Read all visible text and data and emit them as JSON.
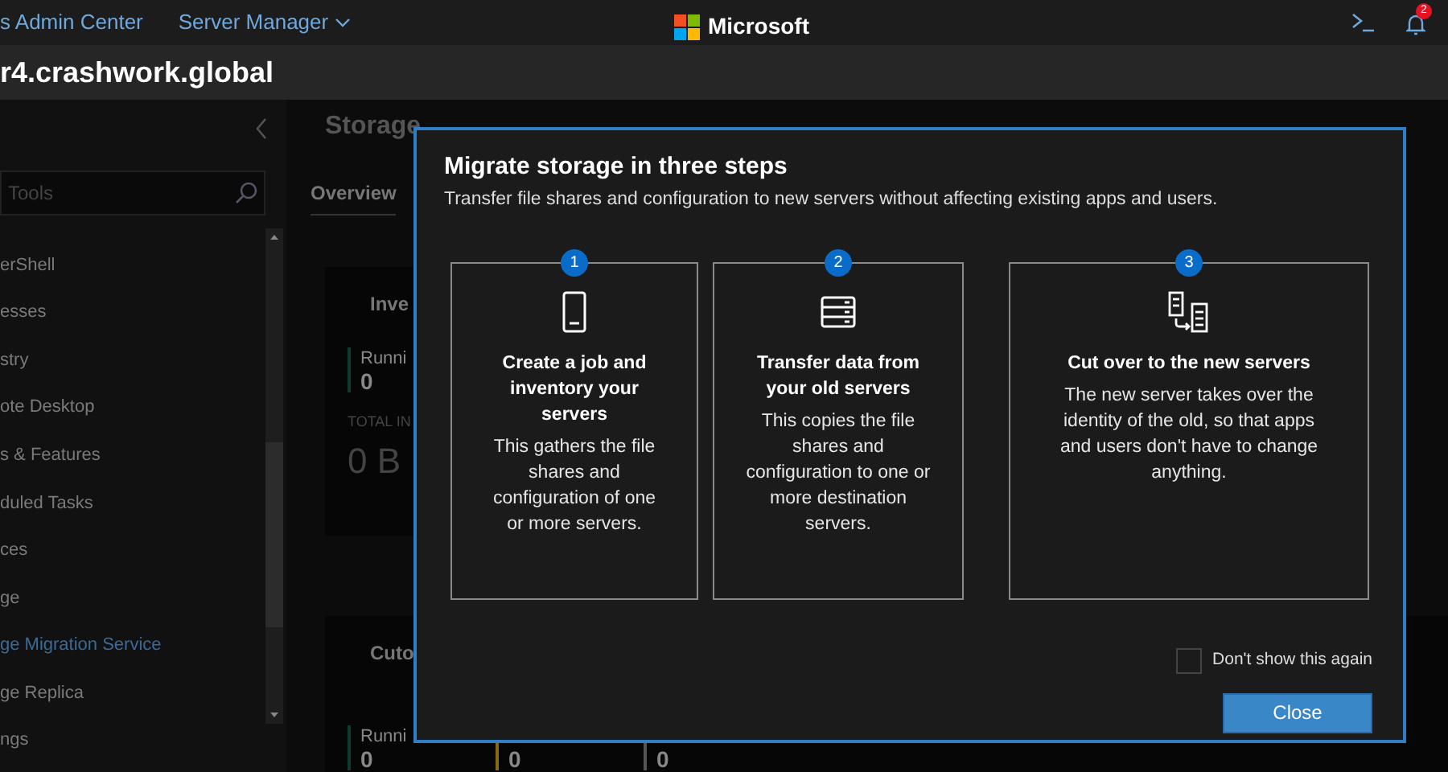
{
  "top_bar": {
    "app_title": "s Admin Center",
    "menu": "Server Manager",
    "brand": "Microsoft",
    "notification_count": "2"
  },
  "header": {
    "server_name": "r4.crashwork.global"
  },
  "sidebar": {
    "search": {
      "placeholder": "Tools"
    },
    "items": [
      {
        "label": "erShell",
        "selected": false
      },
      {
        "label": "esses",
        "selected": false
      },
      {
        "label": "stry",
        "selected": false
      },
      {
        "label": "ote Desktop",
        "selected": false
      },
      {
        "label": "s & Features",
        "selected": false
      },
      {
        "label": "duled Tasks",
        "selected": false
      },
      {
        "label": "ces",
        "selected": false
      },
      {
        "label": "ge",
        "selected": false
      },
      {
        "label": "ge Migration Service",
        "selected": true
      },
      {
        "label": "ge Replica",
        "selected": false
      },
      {
        "label": "ngs",
        "selected": false
      }
    ]
  },
  "tool": {
    "title": "Storage",
    "tabs": [
      {
        "label": "Overview",
        "selected": true
      }
    ],
    "cards": [
      {
        "title": "Inve",
        "stats": [
          {
            "label": "Runni",
            "value": "0",
            "color": "#0e3b2f"
          }
        ],
        "total_label": "TOTAL IN",
        "total_value": "0 B"
      },
      {
        "title": "Cuto",
        "stats": [
          {
            "label": "Runni",
            "value": "0",
            "color": "#0e3b2f"
          },
          {
            "value": "0",
            "color": "#8a6a10"
          },
          {
            "value": "0",
            "color": "#555555"
          }
        ]
      }
    ]
  },
  "dialog": {
    "title": "Migrate storage in three steps",
    "subtitle": "Transfer file shares and configuration to new servers without affecting existing apps and users.",
    "steps": [
      {
        "number": "1",
        "kind": "phone",
        "title": "Create a job and inventory your servers",
        "body": "This gathers the file shares and configuration of one or more servers."
      },
      {
        "number": "2",
        "kind": "server",
        "title": "Transfer data from your old servers",
        "body": "This copies the file shares and configuration to one or more destination servers."
      },
      {
        "number": "3",
        "kind": "transfer",
        "title": "Cut over to the new servers",
        "body": "The new server takes over the identity of the old, so that apps and users don't have to change anything."
      }
    ],
    "dont_show_again": {
      "label": "Don't show this again",
      "checked": false
    },
    "close_button": "Close"
  }
}
